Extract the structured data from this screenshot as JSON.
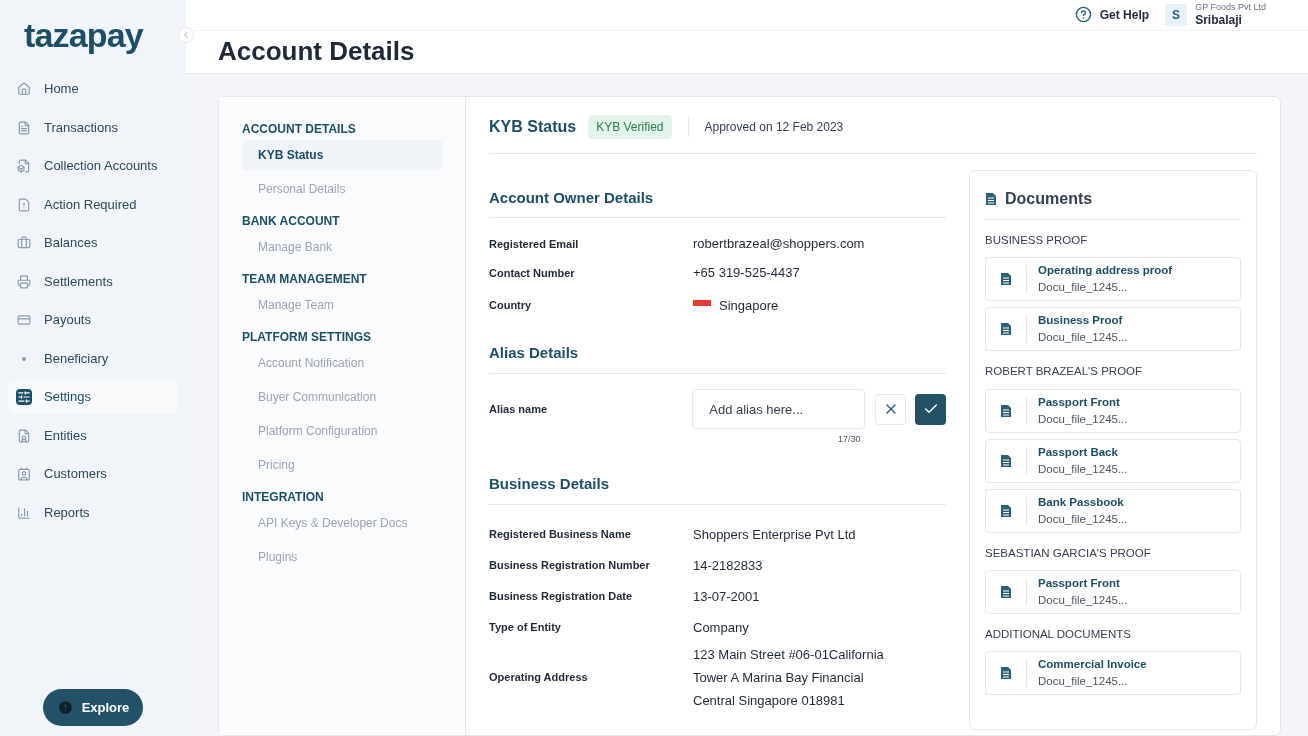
{
  "logo": "tazapay",
  "sidebar": {
    "items": [
      {
        "label": "Home",
        "selected": false
      },
      {
        "label": "Transactions",
        "selected": false
      },
      {
        "label": "Collection Accounts",
        "selected": false
      },
      {
        "label": "Action Required",
        "selected": false
      },
      {
        "label": "Balances",
        "selected": false
      },
      {
        "label": "Settlements",
        "selected": false
      },
      {
        "label": "Payouts",
        "selected": false
      },
      {
        "label": "Beneficiary",
        "selected": false
      },
      {
        "label": "Settings",
        "selected": true
      },
      {
        "label": "Entities",
        "selected": false
      },
      {
        "label": "Customers",
        "selected": false
      },
      {
        "label": "Reports",
        "selected": false
      }
    ],
    "explore_button": "Explore"
  },
  "header": {
    "help": "Get Help",
    "avatar": "S",
    "company": "GP Foods Pvt Ltd",
    "user": "Sribalaji"
  },
  "page_title": "Account Details",
  "settings_nav": [
    {
      "heading": "ACCOUNT DETAILS",
      "items": [
        {
          "label": "KYB Status",
          "selected": true
        },
        {
          "label": "Personal Details",
          "selected": false
        }
      ]
    },
    {
      "heading": "BANK ACCOUNT",
      "items": [
        {
          "label": "Manage Bank",
          "selected": false
        }
      ]
    },
    {
      "heading": "TEAM MANAGEMENT",
      "items": [
        {
          "label": "Manage Team",
          "selected": false
        }
      ]
    },
    {
      "heading": "PLATFORM SETTINGS",
      "items": [
        {
          "label": "Account Notification",
          "selected": false
        },
        {
          "label": "Buyer Communication",
          "selected": false
        },
        {
          "label": "Platform Configuration",
          "selected": false
        },
        {
          "label": "Pricing",
          "selected": false
        }
      ]
    },
    {
      "heading": "INTEGRATION",
      "items": [
        {
          "label": "API Keys & Developer Docs",
          "selected": false
        },
        {
          "label": "Plugins",
          "selected": false
        }
      ]
    }
  ],
  "kyb": {
    "title": "KYB Status",
    "badge": "KYB Verified",
    "approved": "Approved on 12 Feb 2023"
  },
  "account_owner": {
    "title": "Account Owner Details",
    "rows": [
      {
        "label": "Registered Email",
        "value": "robertbrazeal@shoppers.com"
      },
      {
        "label": "Contact Number",
        "value": "+65 319-525-4437"
      },
      {
        "label": "Country",
        "value": "Singapore"
      }
    ]
  },
  "alias": {
    "title": "Alias Details",
    "label": "Alias name",
    "placeholder": "Add alias here...",
    "counter": "17/30"
  },
  "business": {
    "title": "Business Details",
    "rows": [
      {
        "label": "Registered Business Name",
        "lines": [
          "Shoppers Enterprise Pvt Ltd"
        ]
      },
      {
        "label": "Business Registration Number",
        "lines": [
          "14-2182833"
        ]
      },
      {
        "label": "Business Registration Date",
        "lines": [
          "13-07-2001"
        ]
      },
      {
        "label": "Type of Entity",
        "lines": [
          "Company"
        ]
      },
      {
        "label": "Operating Address",
        "lines": [
          "123 Main Street #06-01California",
          "Tower A Marina Bay Financial",
          "Central Singapore 018981"
        ]
      }
    ]
  },
  "documents": {
    "title": "Documents",
    "groups": [
      {
        "heading": "BUSINESS PROOF",
        "files": [
          {
            "name": "Operating address proof",
            "file": "Docu_file_1245..."
          },
          {
            "name": "Business Proof",
            "file": "Docu_file_1245..."
          }
        ]
      },
      {
        "heading": "ROBERT BRAZEAL'S PROOF",
        "files": [
          {
            "name": "Passport Front",
            "file": "Docu_file_1245..."
          },
          {
            "name": "Passport Back",
            "file": "Docu_file_1245..."
          },
          {
            "name": "Bank Passbook",
            "file": "Docu_file_1245..."
          }
        ]
      },
      {
        "heading": "SEBASTIAN GARCIA'S PROOF",
        "files": [
          {
            "name": "Passport Front",
            "file": "Docu_file_1245..."
          }
        ]
      },
      {
        "heading": "ADDITIONAL DOCUMENTS",
        "files": [
          {
            "name": "Commercial Invoice",
            "file": "Docu_file_1245..."
          }
        ]
      }
    ]
  }
}
